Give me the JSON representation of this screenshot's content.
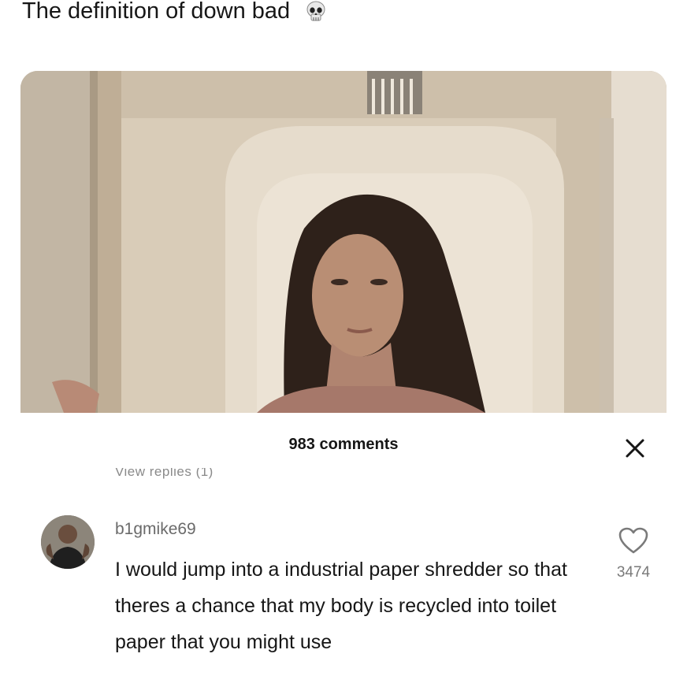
{
  "post": {
    "caption": "The definition of down bad",
    "caption_emoji": "skull-emoji"
  },
  "comments_panel": {
    "count_label": "983 comments",
    "view_replies_label": "View replies (1)",
    "close_icon": "close-icon"
  },
  "comment": {
    "username": "b1gmike69",
    "text": "I would jump into a industrial paper shredder so that theres a chance that my body is recycled into toilet paper that you might use",
    "like_count": "3474",
    "like_icon": "heart-outline-icon"
  }
}
